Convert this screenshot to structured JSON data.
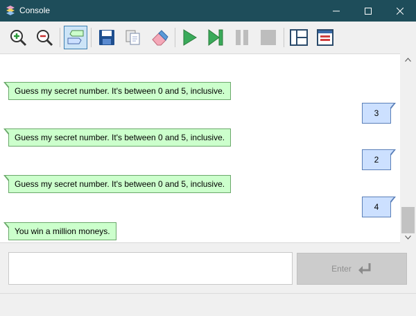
{
  "window": {
    "title": "Console",
    "controls": [
      "minimize",
      "maximize",
      "close"
    ]
  },
  "toolbar": {
    "buttons": [
      {
        "icon": "zoom-in-icon"
      },
      {
        "icon": "zoom-out-icon"
      },
      {
        "icon": "speech-bubbles-icon",
        "active": true
      },
      {
        "icon": "save-icon"
      },
      {
        "icon": "copy-icon"
      },
      {
        "icon": "eraser-icon"
      },
      {
        "icon": "play-icon"
      },
      {
        "icon": "step-icon"
      },
      {
        "icon": "pause-icon"
      },
      {
        "icon": "stop-icon"
      },
      {
        "icon": "layout-split-icon"
      },
      {
        "icon": "layout-list-icon"
      }
    ]
  },
  "messages": [
    {
      "from": "program",
      "text": "Guess my secret number. It's between 0 and 5, inclusive."
    },
    {
      "from": "user",
      "text": "3"
    },
    {
      "from": "program",
      "text": "Guess my secret number. It's between 0 and 5, inclusive."
    },
    {
      "from": "user",
      "text": "2"
    },
    {
      "from": "program",
      "text": "Guess my secret number. It's between 0 and 5, inclusive."
    },
    {
      "from": "user",
      "text": "4"
    },
    {
      "from": "program",
      "text": "You win a million moneys."
    }
  ],
  "input": {
    "value": "",
    "placeholder": ""
  },
  "enter_button": {
    "label": "Enter",
    "disabled": true
  },
  "colors": {
    "titlebar": "#1e4d5a",
    "program_bubble": "#ccffcc",
    "user_bubble": "#cce0ff"
  }
}
